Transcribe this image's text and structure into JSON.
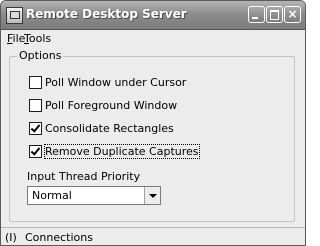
{
  "window": {
    "title": "Remote Desktop Server"
  },
  "menubar": {
    "file_label": [
      "F",
      "ile"
    ],
    "tools_label": [
      "T",
      "ools"
    ]
  },
  "options": {
    "group_label": "Options",
    "checkboxes": [
      {
        "label": "Poll Window under Cursor",
        "checked": false
      },
      {
        "label": "Poll Foreground Window",
        "checked": false
      },
      {
        "label": "Consolidate Rectangles",
        "checked": true
      },
      {
        "label": "Remove Duplicate Captures",
        "checked": true
      }
    ],
    "priority_label": "Input Thread Priority",
    "priority_value": "Normal"
  },
  "statusbar": {
    "count": "(I)",
    "text": "Connections"
  }
}
